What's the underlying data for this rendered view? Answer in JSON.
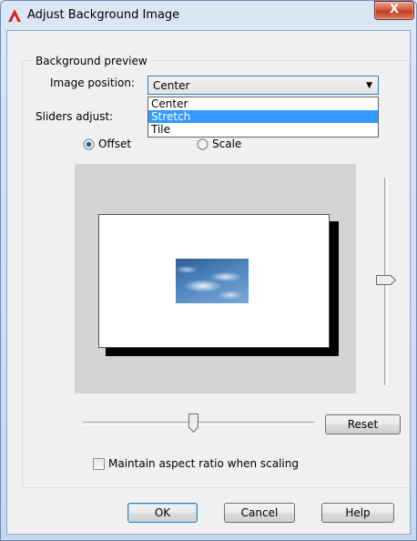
{
  "window": {
    "title": "Adjust Background Image",
    "close_label": "X"
  },
  "group": {
    "label": "Background preview"
  },
  "image_position": {
    "label": "Image position:",
    "value": "Center",
    "options": [
      "Center",
      "Stretch",
      "Tile"
    ],
    "highlighted": "Stretch"
  },
  "sliders": {
    "label": "Sliders adjust:",
    "offset_label": "Offset",
    "scale_label": "Scale",
    "selected": "Offset",
    "horizontal_level": 0.5,
    "vertical_level": 0.5
  },
  "buttons": {
    "reset": "Reset",
    "ok": "OK",
    "cancel": "Cancel",
    "help": "Help"
  },
  "checkbox": {
    "label": "Maintain aspect ratio when scaling",
    "checked": false
  },
  "colors": {
    "accent": "#3399ff",
    "close_button": "#c23c23",
    "preview_bg": "#d4d4d4"
  },
  "icons": [
    "autocad-app-icon",
    "close-icon",
    "chevron-down-icon"
  ]
}
